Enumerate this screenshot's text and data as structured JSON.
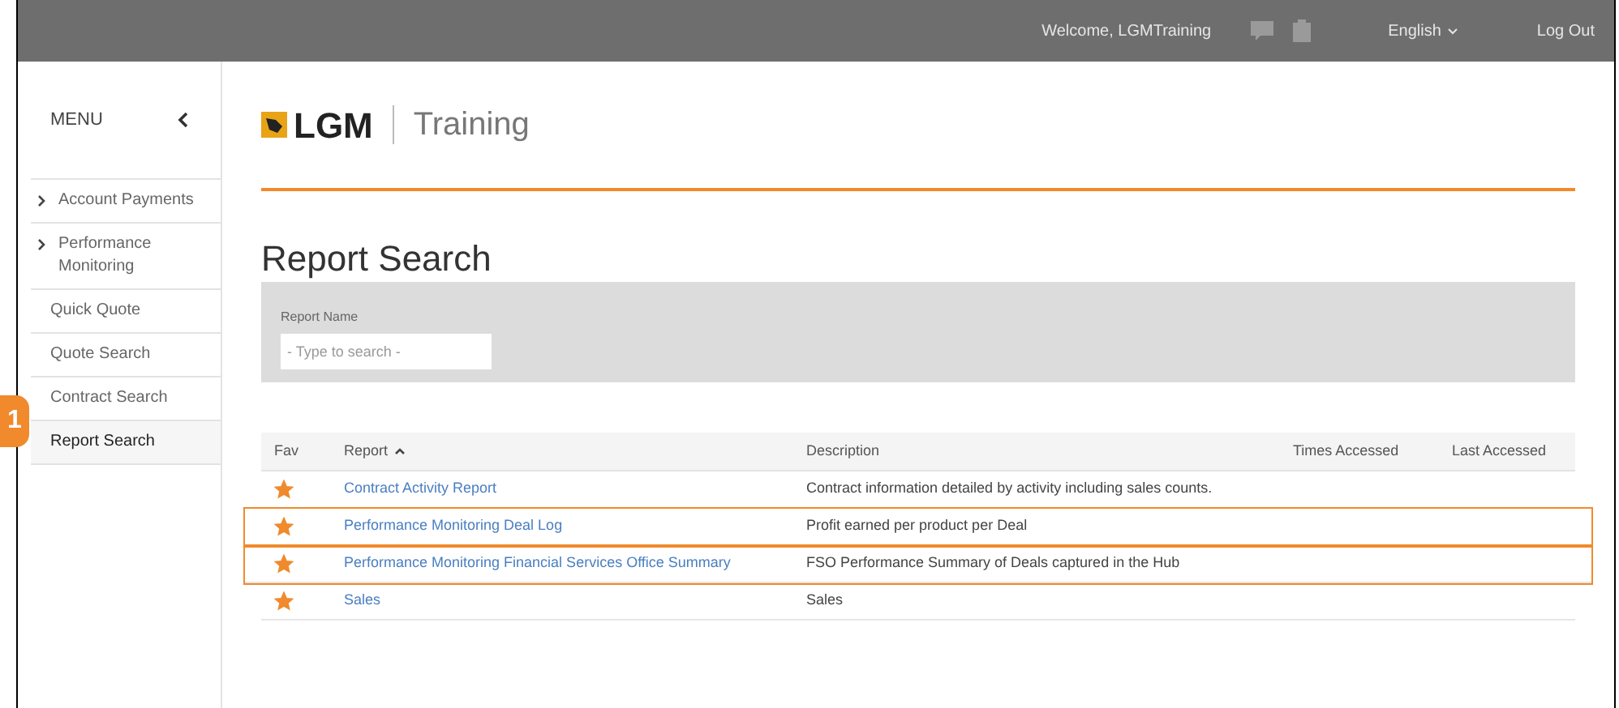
{
  "top_bar": {
    "welcome": "Welcome, LGMTraining",
    "language": "English",
    "logout": "Log Out"
  },
  "sidebar": {
    "title": "MENU",
    "items": [
      {
        "label": "Account Payments",
        "expandable": true,
        "selected": false
      },
      {
        "label": "Performance Monitoring",
        "expandable": true,
        "selected": false
      },
      {
        "label": "Quick Quote",
        "expandable": false,
        "selected": false
      },
      {
        "label": "Quote Search",
        "expandable": false,
        "selected": false
      },
      {
        "label": "Contract Search",
        "expandable": false,
        "selected": false
      },
      {
        "label": "Report Search",
        "expandable": false,
        "selected": true
      }
    ]
  },
  "callout": "1",
  "logo": {
    "brand": "LGM",
    "product": "Training"
  },
  "page_title": "Report Search",
  "filter": {
    "label": "Report Name",
    "placeholder": "- Type to search -"
  },
  "table": {
    "columns": [
      "Fav",
      "Report",
      "Description",
      "Times Accessed",
      "Last Accessed"
    ],
    "rows": [
      {
        "favorite": true,
        "report": "Contract Activity Report",
        "description": "Contract information detailed by activity including sales counts.",
        "highlighted": false
      },
      {
        "favorite": true,
        "report": "Performance Monitoring Deal Log",
        "description": "Profit earned per product per Deal",
        "highlighted": true
      },
      {
        "favorite": true,
        "report": "Performance Monitoring Financial Services Office Summary",
        "description": "FSO Performance Summary of Deals captured in the Hub",
        "highlighted": true
      },
      {
        "favorite": true,
        "report": "Sales",
        "description": "Sales",
        "highlighted": false
      }
    ]
  }
}
